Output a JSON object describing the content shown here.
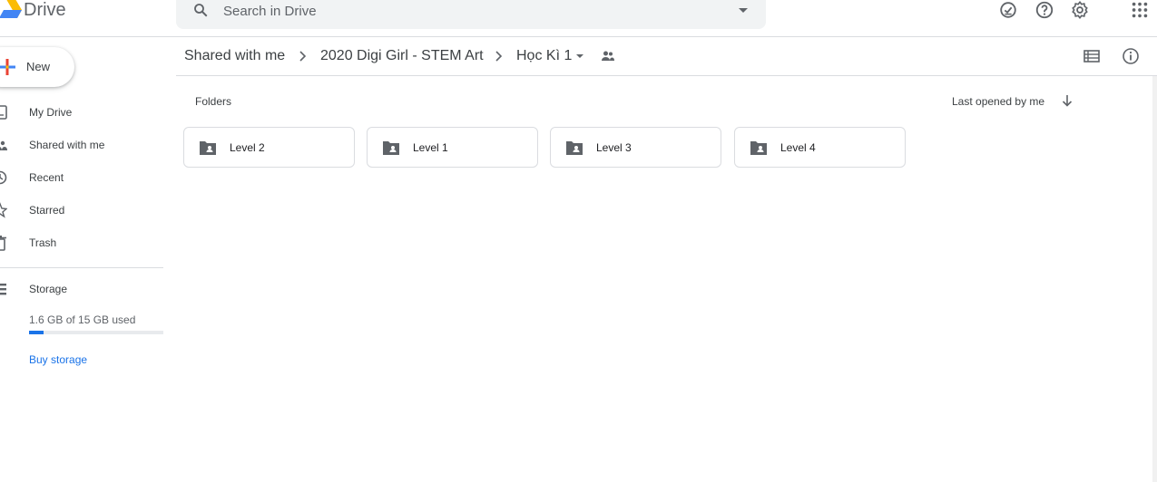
{
  "app": {
    "name": "Drive"
  },
  "search": {
    "placeholder": "Search in Drive"
  },
  "header_icons": [
    "offline-ready-icon",
    "help-icon",
    "settings-icon",
    "apps-grid-icon"
  ],
  "sidebar": {
    "new_label": "New",
    "items": [
      {
        "label": "My Drive",
        "icon": "my-drive-icon"
      },
      {
        "label": "Shared with me",
        "icon": "shared-icon"
      },
      {
        "label": "Recent",
        "icon": "clock-icon"
      },
      {
        "label": "Starred",
        "icon": "star-icon"
      },
      {
        "label": "Trash",
        "icon": "trash-icon"
      }
    ],
    "storage": {
      "label": "Storage",
      "usage_text": "1.6 GB of 15 GB used",
      "used_fraction": 0.107,
      "buy_label": "Buy storage"
    }
  },
  "breadcrumb": [
    "Shared with me",
    "2020 Digi Girl - STEM Art",
    "Học Kì 1"
  ],
  "content": {
    "section_title": "Folders",
    "sort_label": "Last opened by me",
    "folders": [
      {
        "name": "Level 2"
      },
      {
        "name": "Level 1"
      },
      {
        "name": "Level 3"
      },
      {
        "name": "Level 4"
      }
    ]
  },
  "colors": {
    "accent": "#1a73e8",
    "text": "#3c4043",
    "border": "#dadce0"
  }
}
